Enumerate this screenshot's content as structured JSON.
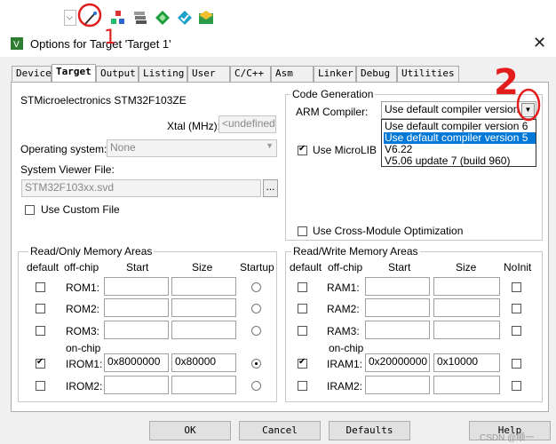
{
  "window": {
    "title": "Options for Target 'Target 1'"
  },
  "tabs": [
    "Device",
    "Target",
    "Output",
    "Listing",
    "User",
    "C/C++",
    "Asm",
    "Linker",
    "Debug",
    "Utilities"
  ],
  "device": {
    "name": "STMicroelectronics STM32F103ZE",
    "xtal_label": "Xtal (MHz):",
    "xtal_value": "<undefined>",
    "os_label": "Operating system:",
    "os_value": "None",
    "svf_label": "System Viewer File:",
    "svf_value": "STM32F103xx.svd",
    "browse_label": "...",
    "custom_file_label": "Use Custom File"
  },
  "codegen": {
    "group_label": "Code Generation",
    "compiler_label": "ARM Compiler:",
    "compiler_value": "Use default compiler version 5",
    "options": [
      "Use default compiler version 6",
      "Use default compiler version 5",
      "V6.22",
      "V5.06 update 7 (build 960)"
    ],
    "highlighted_index": 1,
    "microlib_label": "Use MicroLIB",
    "microlib_checked": true,
    "cross_module_label": "Use Cross-Module Optimization",
    "cross_module_checked": false
  },
  "rom": {
    "group_label": "Read/Only Memory Areas",
    "headers": {
      "default": "default",
      "offchip": "off-chip",
      "start": "Start",
      "size": "Size",
      "startup": "Startup"
    },
    "onchip_label": "on-chip",
    "rows": [
      {
        "name": "ROM1:",
        "start": "",
        "size": "",
        "default": false,
        "startup": false
      },
      {
        "name": "ROM2:",
        "start": "",
        "size": "",
        "default": false,
        "startup": false
      },
      {
        "name": "ROM3:",
        "start": "",
        "size": "",
        "default": false,
        "startup": false
      },
      {
        "name": "IROM1:",
        "start": "0x8000000",
        "size": "0x80000",
        "default": true,
        "startup": true
      },
      {
        "name": "IROM2:",
        "start": "",
        "size": "",
        "default": false,
        "startup": false
      }
    ]
  },
  "ram": {
    "group_label": "Read/Write Memory Areas",
    "headers": {
      "default": "default",
      "offchip": "off-chip",
      "start": "Start",
      "size": "Size",
      "noinit": "NoInit"
    },
    "onchip_label": "on-chip",
    "rows": [
      {
        "name": "RAM1:",
        "start": "",
        "size": "",
        "default": false,
        "noinit": false
      },
      {
        "name": "RAM2:",
        "start": "",
        "size": "",
        "default": false,
        "noinit": false
      },
      {
        "name": "RAM3:",
        "start": "",
        "size": "",
        "default": false,
        "noinit": false
      },
      {
        "name": "IRAM1:",
        "start": "0x20000000",
        "size": "0x10000",
        "default": true,
        "noinit": false
      },
      {
        "name": "IRAM2:",
        "start": "",
        "size": "",
        "default": false,
        "noinit": false
      }
    ]
  },
  "buttons": {
    "ok": "OK",
    "cancel": "Cancel",
    "defaults": "Defaults",
    "help": "Help"
  },
  "annotations": {
    "mark1": "1",
    "mark2": "2"
  },
  "watermark": "CSDN @顺一",
  "colors": {
    "highlight": "#0078d7",
    "annotation": "#e31c1c"
  }
}
